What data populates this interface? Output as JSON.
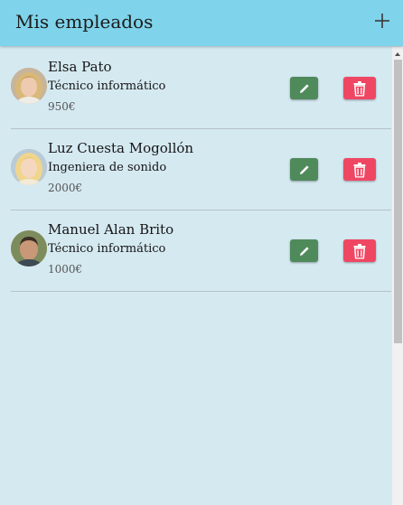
{
  "header": {
    "title": "Mis empleados",
    "add_icon": "plus-icon"
  },
  "employees": [
    {
      "name": "Elsa Pato",
      "role": "Técnico informático",
      "salary": "950€",
      "avatar": "woman-avatar"
    },
    {
      "name": "Luz Cuesta Mogollón",
      "role": "Ingeniera de sonido",
      "salary": "2000€",
      "avatar": "woman-avatar"
    },
    {
      "name": "Manuel Alan Brito",
      "role": "Técnico informático",
      "salary": "1000€",
      "avatar": "man-avatar"
    }
  ],
  "actions": {
    "edit_icon": "pencil-icon",
    "delete_icon": "trash-icon"
  },
  "colors": {
    "header_bg": "#7fd3ea",
    "page_bg": "#d5e9f1",
    "edit_button": "#4f8a5b",
    "delete_button": "#ef4763"
  }
}
